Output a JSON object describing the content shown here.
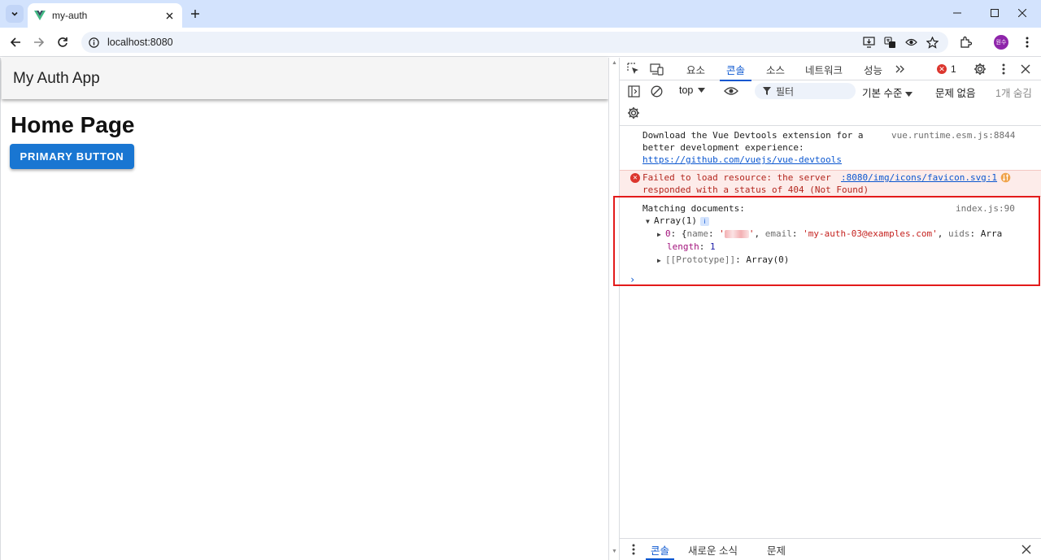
{
  "browser": {
    "tab_title": "my-auth",
    "url": "localhost:8080",
    "profile_initials": "원수"
  },
  "page": {
    "app_title": "My Auth App",
    "heading": "Home Page",
    "primary_button": "PRIMARY BUTTON"
  },
  "devtools": {
    "tabs": [
      "요소",
      "콘솔",
      "소스",
      "네트워크",
      "성능"
    ],
    "active_tab": "콘솔",
    "error_count": "1",
    "context": "top",
    "filter_placeholder": "필터",
    "log_level": "기본 수준",
    "issues": "문제 없음",
    "hidden": "1개 숨김",
    "messages": {
      "vue": {
        "line1": "Download the Vue Devtools extension for a",
        "line2": "better development experience:",
        "link": "https://github.com/vuejs/vue-devtools",
        "source": "vue.runtime.esm.js:8844"
      },
      "error": {
        "line1": "Failed to load resource: the server",
        "line2": "responded with a status of 404 (Not Found)",
        "source": ":8080/img/icons/favicon.svg:1"
      },
      "log": {
        "label": "Matching documents:",
        "source": "index.js:90",
        "array_label": "Array(1)",
        "item_index": "0",
        "item_name_key": "name",
        "item_email_key": "email",
        "item_email": "'my-auth-03@examples.com'",
        "item_uids_key": "uids",
        "item_uids_value": "Arra",
        "length_key": "length",
        "length_value": "1",
        "prototype_key": "[[Prototype]]",
        "prototype_value": "Array(0)"
      }
    },
    "drawer_tabs": [
      "콘솔",
      "새로운 소식",
      "문제"
    ],
    "drawer_active": "콘솔"
  },
  "colors": {
    "accent": "#0b57d0",
    "primary_button": "#1976d2",
    "error": "#dc362e",
    "highlight": "#e31b1b"
  }
}
